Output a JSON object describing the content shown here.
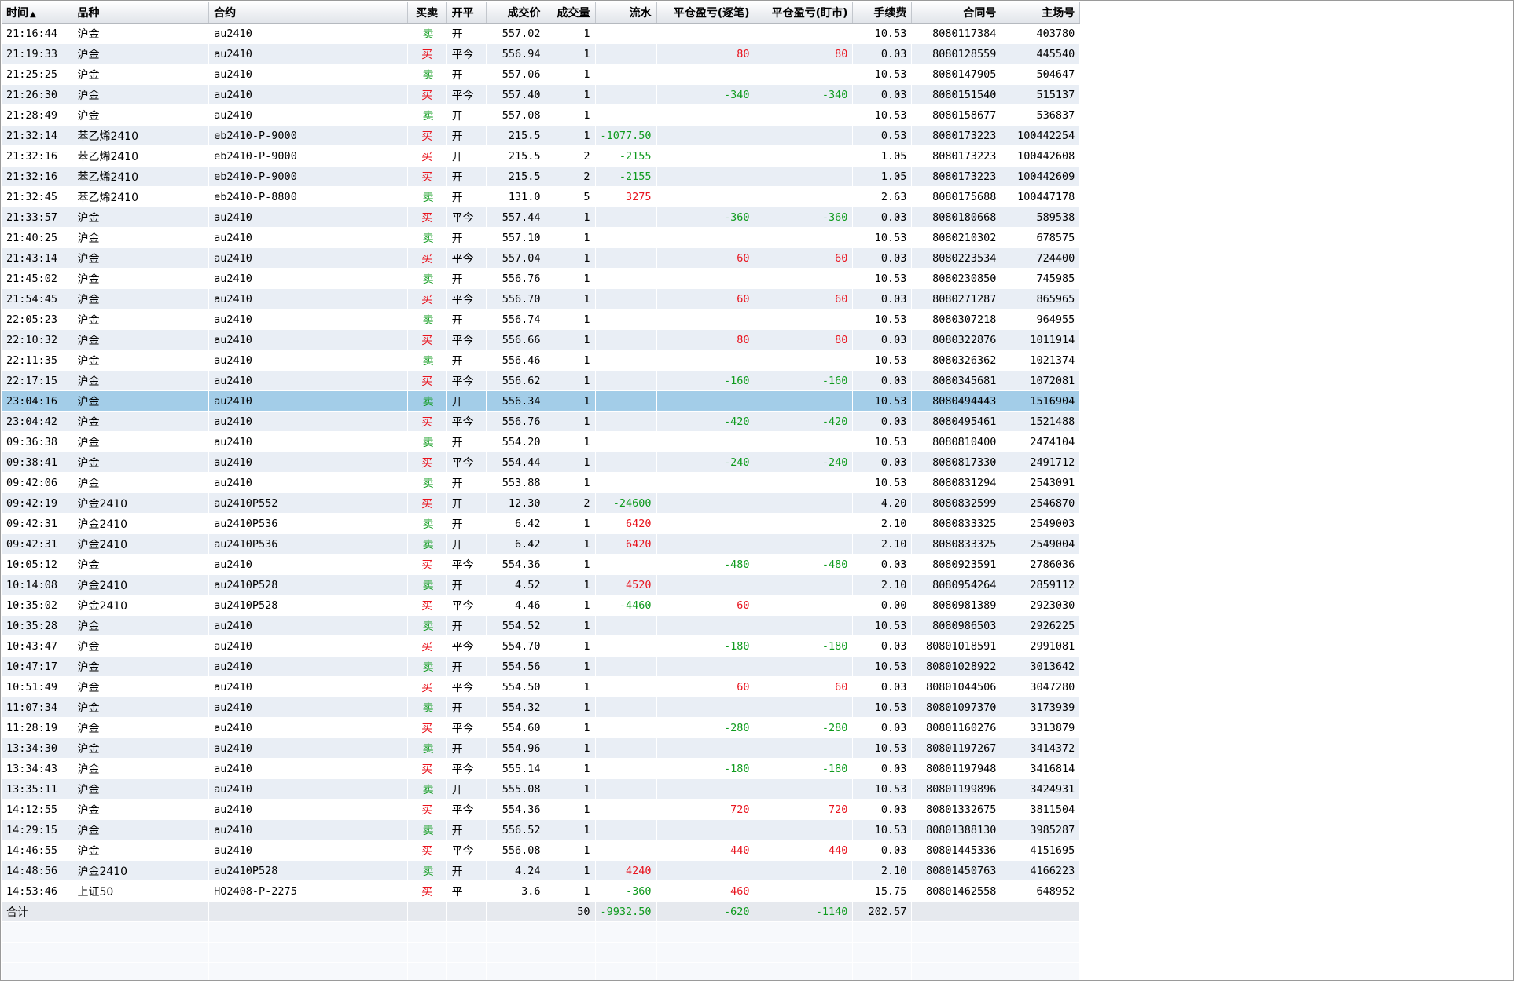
{
  "columns": [
    {
      "label": "时间",
      "sort": "▲",
      "align": "l"
    },
    {
      "label": "品种",
      "align": "l"
    },
    {
      "label": "合约",
      "align": "l"
    },
    {
      "label": "买卖",
      "align": "c"
    },
    {
      "label": "开平",
      "align": "l"
    },
    {
      "label": "成交价",
      "align": "r"
    },
    {
      "label": "成交量",
      "align": "r"
    },
    {
      "label": "流水",
      "align": "r"
    },
    {
      "label": "平仓盈亏(逐笔)",
      "align": "r"
    },
    {
      "label": "平仓盈亏(盯市)",
      "align": "r"
    },
    {
      "label": "手续费",
      "align": "r"
    },
    {
      "label": "合同号",
      "align": "r"
    },
    {
      "label": "主场号",
      "align": "r"
    }
  ],
  "rows": [
    [
      "21:16:44",
      "沪金",
      "au2410",
      "卖",
      "开",
      "557.02",
      "1",
      "",
      "",
      "",
      "10.53",
      "8080117384",
      "403780"
    ],
    [
      "21:19:33",
      "沪金",
      "au2410",
      "买",
      "平今",
      "556.94",
      "1",
      "",
      "80",
      "80",
      "0.03",
      "8080128559",
      "445540"
    ],
    [
      "21:25:25",
      "沪金",
      "au2410",
      "卖",
      "开",
      "557.06",
      "1",
      "",
      "",
      "",
      "10.53",
      "8080147905",
      "504647"
    ],
    [
      "21:26:30",
      "沪金",
      "au2410",
      "买",
      "平今",
      "557.40",
      "1",
      "",
      "-340",
      "-340",
      "0.03",
      "8080151540",
      "515137"
    ],
    [
      "21:28:49",
      "沪金",
      "au2410",
      "卖",
      "开",
      "557.08",
      "1",
      "",
      "",
      "",
      "10.53",
      "8080158677",
      "536837"
    ],
    [
      "21:32:14",
      "苯乙烯2410",
      "eb2410-P-9000",
      "买",
      "开",
      "215.5",
      "1",
      "-1077.50",
      "",
      "",
      "0.53",
      "8080173223",
      "100442254"
    ],
    [
      "21:32:16",
      "苯乙烯2410",
      "eb2410-P-9000",
      "买",
      "开",
      "215.5",
      "2",
      "-2155",
      "",
      "",
      "1.05",
      "8080173223",
      "100442608"
    ],
    [
      "21:32:16",
      "苯乙烯2410",
      "eb2410-P-9000",
      "买",
      "开",
      "215.5",
      "2",
      "-2155",
      "",
      "",
      "1.05",
      "8080173223",
      "100442609"
    ],
    [
      "21:32:45",
      "苯乙烯2410",
      "eb2410-P-8800",
      "卖",
      "开",
      "131.0",
      "5",
      "3275",
      "",
      "",
      "2.63",
      "8080175688",
      "100447178"
    ],
    [
      "21:33:57",
      "沪金",
      "au2410",
      "买",
      "平今",
      "557.44",
      "1",
      "",
      "-360",
      "-360",
      "0.03",
      "8080180668",
      "589538"
    ],
    [
      "21:40:25",
      "沪金",
      "au2410",
      "卖",
      "开",
      "557.10",
      "1",
      "",
      "",
      "",
      "10.53",
      "8080210302",
      "678575"
    ],
    [
      "21:43:14",
      "沪金",
      "au2410",
      "买",
      "平今",
      "557.04",
      "1",
      "",
      "60",
      "60",
      "0.03",
      "8080223534",
      "724400"
    ],
    [
      "21:45:02",
      "沪金",
      "au2410",
      "卖",
      "开",
      "556.76",
      "1",
      "",
      "",
      "",
      "10.53",
      "8080230850",
      "745985"
    ],
    [
      "21:54:45",
      "沪金",
      "au2410",
      "买",
      "平今",
      "556.70",
      "1",
      "",
      "60",
      "60",
      "0.03",
      "8080271287",
      "865965"
    ],
    [
      "22:05:23",
      "沪金",
      "au2410",
      "卖",
      "开",
      "556.74",
      "1",
      "",
      "",
      "",
      "10.53",
      "8080307218",
      "964955"
    ],
    [
      "22:10:32",
      "沪金",
      "au2410",
      "买",
      "平今",
      "556.66",
      "1",
      "",
      "80",
      "80",
      "0.03",
      "8080322876",
      "1011914"
    ],
    [
      "22:11:35",
      "沪金",
      "au2410",
      "卖",
      "开",
      "556.46",
      "1",
      "",
      "",
      "",
      "10.53",
      "8080326362",
      "1021374"
    ],
    [
      "22:17:15",
      "沪金",
      "au2410",
      "买",
      "平今",
      "556.62",
      "1",
      "",
      "-160",
      "-160",
      "0.03",
      "8080345681",
      "1072081"
    ],
    [
      "23:04:16",
      "沪金",
      "au2410",
      "卖",
      "开",
      "556.34",
      "1",
      "",
      "",
      "",
      "10.53",
      "8080494443",
      "1516904"
    ],
    [
      "23:04:42",
      "沪金",
      "au2410",
      "买",
      "平今",
      "556.76",
      "1",
      "",
      "-420",
      "-420",
      "0.03",
      "8080495461",
      "1521488"
    ],
    [
      "09:36:38",
      "沪金",
      "au2410",
      "卖",
      "开",
      "554.20",
      "1",
      "",
      "",
      "",
      "10.53",
      "8080810400",
      "2474104"
    ],
    [
      "09:38:41",
      "沪金",
      "au2410",
      "买",
      "平今",
      "554.44",
      "1",
      "",
      "-240",
      "-240",
      "0.03",
      "8080817330",
      "2491712"
    ],
    [
      "09:42:06",
      "沪金",
      "au2410",
      "卖",
      "开",
      "553.88",
      "1",
      "",
      "",
      "",
      "10.53",
      "8080831294",
      "2543091"
    ],
    [
      "09:42:19",
      "沪金2410",
      "au2410P552",
      "买",
      "开",
      "12.30",
      "2",
      "-24600",
      "",
      "",
      "4.20",
      "8080832599",
      "2546870"
    ],
    [
      "09:42:31",
      "沪金2410",
      "au2410P536",
      "卖",
      "开",
      "6.42",
      "1",
      "6420",
      "",
      "",
      "2.10",
      "8080833325",
      "2549003"
    ],
    [
      "09:42:31",
      "沪金2410",
      "au2410P536",
      "卖",
      "开",
      "6.42",
      "1",
      "6420",
      "",
      "",
      "2.10",
      "8080833325",
      "2549004"
    ],
    [
      "10:05:12",
      "沪金",
      "au2410",
      "买",
      "平今",
      "554.36",
      "1",
      "",
      "-480",
      "-480",
      "0.03",
      "8080923591",
      "2786036"
    ],
    [
      "10:14:08",
      "沪金2410",
      "au2410P528",
      "卖",
      "开",
      "4.52",
      "1",
      "4520",
      "",
      "",
      "2.10",
      "8080954264",
      "2859112"
    ],
    [
      "10:35:02",
      "沪金2410",
      "au2410P528",
      "买",
      "平今",
      "4.46",
      "1",
      "-4460",
      "60",
      "",
      "0.00",
      "8080981389",
      "2923030"
    ],
    [
      "10:35:28",
      "沪金",
      "au2410",
      "卖",
      "开",
      "554.52",
      "1",
      "",
      "",
      "",
      "10.53",
      "8080986503",
      "2926225"
    ],
    [
      "10:43:47",
      "沪金",
      "au2410",
      "买",
      "平今",
      "554.70",
      "1",
      "",
      "-180",
      "-180",
      "0.03",
      "80801018591",
      "2991081"
    ],
    [
      "10:47:17",
      "沪金",
      "au2410",
      "卖",
      "开",
      "554.56",
      "1",
      "",
      "",
      "",
      "10.53",
      "80801028922",
      "3013642"
    ],
    [
      "10:51:49",
      "沪金",
      "au2410",
      "买",
      "平今",
      "554.50",
      "1",
      "",
      "60",
      "60",
      "0.03",
      "80801044506",
      "3047280"
    ],
    [
      "11:07:34",
      "沪金",
      "au2410",
      "卖",
      "开",
      "554.32",
      "1",
      "",
      "",
      "",
      "10.53",
      "80801097370",
      "3173939"
    ],
    [
      "11:28:19",
      "沪金",
      "au2410",
      "买",
      "平今",
      "554.60",
      "1",
      "",
      "-280",
      "-280",
      "0.03",
      "80801160276",
      "3313879"
    ],
    [
      "13:34:30",
      "沪金",
      "au2410",
      "卖",
      "开",
      "554.96",
      "1",
      "",
      "",
      "",
      "10.53",
      "80801197267",
      "3414372"
    ],
    [
      "13:34:43",
      "沪金",
      "au2410",
      "买",
      "平今",
      "555.14",
      "1",
      "",
      "-180",
      "-180",
      "0.03",
      "80801197948",
      "3416814"
    ],
    [
      "13:35:11",
      "沪金",
      "au2410",
      "卖",
      "开",
      "555.08",
      "1",
      "",
      "",
      "",
      "10.53",
      "80801199896",
      "3424931"
    ],
    [
      "14:12:55",
      "沪金",
      "au2410",
      "买",
      "平今",
      "554.36",
      "1",
      "",
      "720",
      "720",
      "0.03",
      "80801332675",
      "3811504"
    ],
    [
      "14:29:15",
      "沪金",
      "au2410",
      "卖",
      "开",
      "556.52",
      "1",
      "",
      "",
      "",
      "10.53",
      "80801388130",
      "3985287"
    ],
    [
      "14:46:55",
      "沪金",
      "au2410",
      "买",
      "平今",
      "556.08",
      "1",
      "",
      "440",
      "440",
      "0.03",
      "80801445336",
      "4151695"
    ],
    [
      "14:48:56",
      "沪金2410",
      "au2410P528",
      "卖",
      "开",
      "4.24",
      "1",
      "4240",
      "",
      "",
      "2.10",
      "80801450763",
      "4166223"
    ],
    [
      "14:53:46",
      "上证50",
      "HO2408-P-2275",
      "买",
      "平",
      "3.6",
      "1",
      "-360",
      "460",
      "",
      "15.75",
      "80801462558",
      "648952"
    ]
  ],
  "selected_row_index": 18,
  "total": [
    "合计",
    "",
    "",
    "",
    "",
    "",
    "50",
    "-9932.50",
    "-620",
    "-1140",
    "202.57",
    "",
    ""
  ],
  "colors": {
    "buy": "#e8141e",
    "sell": "#0f9b1e",
    "positive": "#e8141e",
    "negative": "#0f9b1e",
    "selected": "#a3cde8"
  }
}
